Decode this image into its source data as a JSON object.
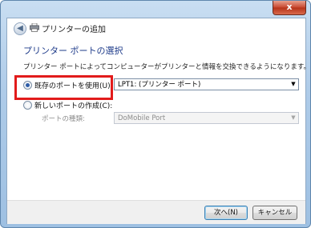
{
  "window": {
    "title": "プリンターの追加",
    "close_label": "x"
  },
  "page": {
    "heading": "プリンター ポートの選択",
    "description": "プリンター ポートによってコンピューターがプリンターと情報を交換できるようになります。"
  },
  "options": {
    "existing_port": {
      "label": "既存のポートを使用(U):",
      "selected": true,
      "value": "LPT1: (プリンター ポート)"
    },
    "new_port": {
      "label": "新しいポートの作成(C):",
      "selected": false,
      "type_label": "ポートの種類:",
      "type_value": "DoMobile Port"
    }
  },
  "buttons": {
    "next": "次へ(N)",
    "cancel": "キャンセル"
  },
  "colors": {
    "heading": "#1e3b8a",
    "highlight": "#e21b1b",
    "close_button": "#c7462e"
  }
}
